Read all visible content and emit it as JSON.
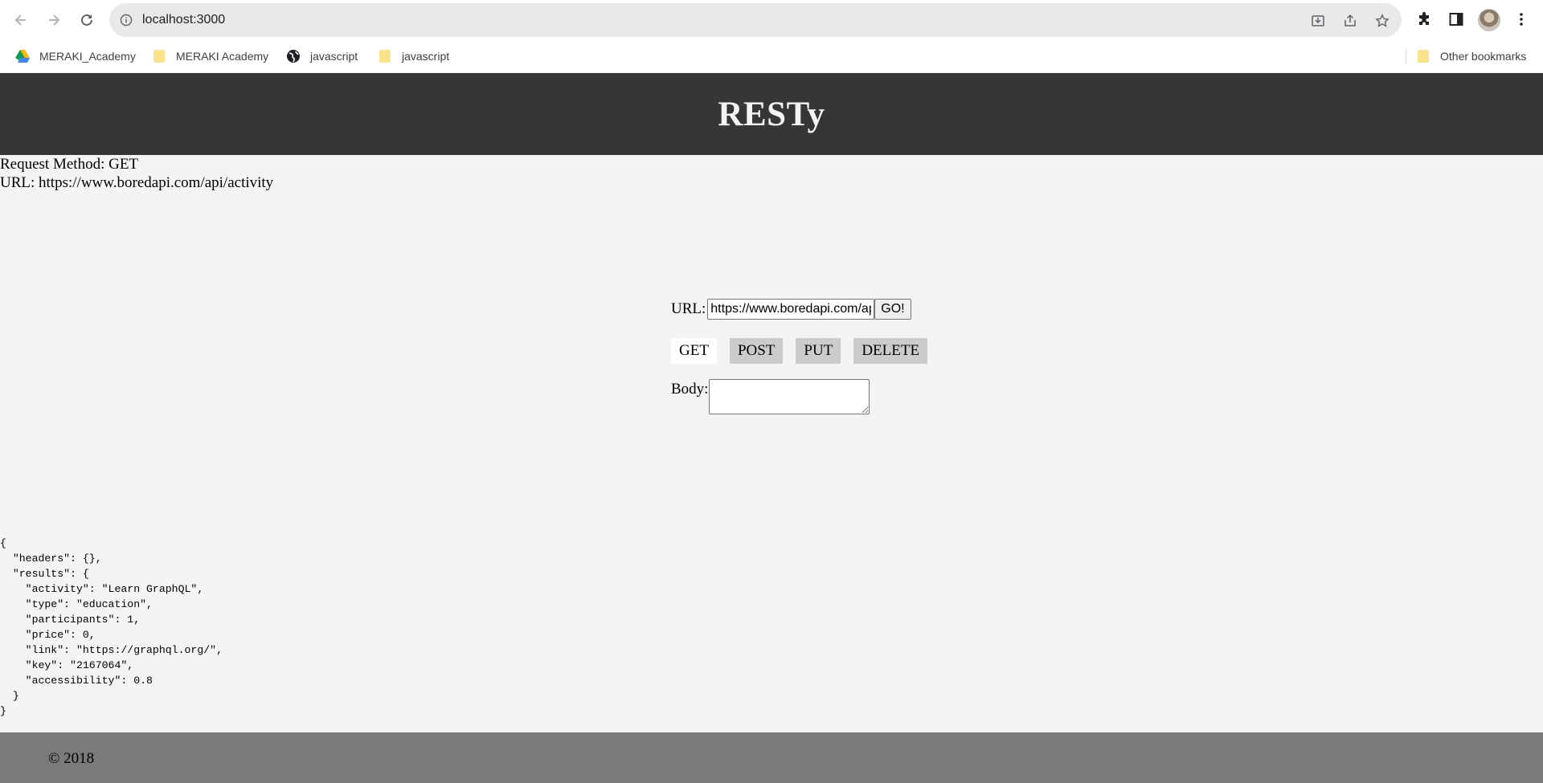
{
  "browser": {
    "address": "localhost:3000",
    "bookmarks": [
      {
        "label": "MERAKI_Academy",
        "icon": "google-drive-icon"
      },
      {
        "label": "MERAKI Academy",
        "icon": "folder-icon"
      },
      {
        "label": "javascript",
        "icon": "globe-icon"
      },
      {
        "label": "javascript",
        "icon": "folder-icon"
      }
    ],
    "other_bookmarks": "Other bookmarks"
  },
  "header": {
    "title": "RESTy"
  },
  "summary": {
    "method_line": "Request Method: GET",
    "url_line": "URL: https://www.boredapi.com/api/activity"
  },
  "form": {
    "url_label": "URL:",
    "url_value": "https://www.boredapi.com/api/activity",
    "go_label": "GO!",
    "methods": [
      "GET",
      "POST",
      "PUT",
      "DELETE"
    ],
    "active_method": "GET",
    "body_label": "Body:"
  },
  "output": {
    "json_text": "{\n  \"headers\": {},\n  \"results\": {\n    \"activity\": \"Learn GraphQL\",\n    \"type\": \"education\",\n    \"participants\": 1,\n    \"price\": 0,\n    \"link\": \"https://graphql.org/\",\n    \"key\": \"2167064\",\n    \"accessibility\": 0.8\n  }\n}"
  },
  "footer": {
    "text": "© 2018"
  },
  "colors": {
    "header_bg": "#363636",
    "page_bg": "#f4f4f4",
    "footer_bg": "#7a7a7a",
    "method_bg": "#cccccc",
    "method_active_bg": "#ffffff"
  }
}
